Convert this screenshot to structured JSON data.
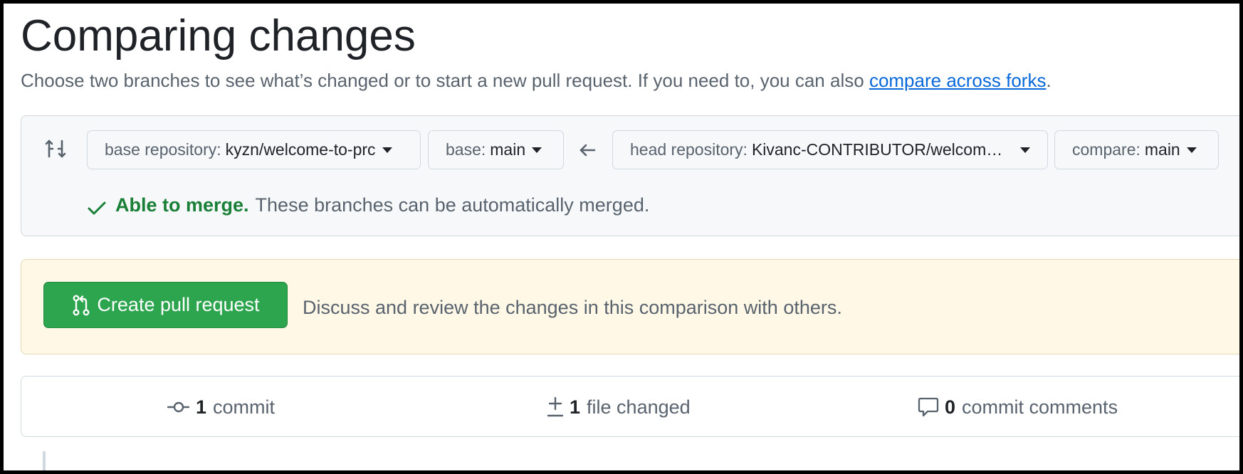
{
  "header": {
    "title": "Comparing changes",
    "subtitle": "Choose two branches to see what’s changed or to start a new pull request. If you need to, you can also",
    "compare_link": "compare across forks",
    "subtitle_end": "."
  },
  "range": {
    "compare_icon": "arrow-switch-icon",
    "base_repository": {
      "label": "base repository:",
      "value": "kyzn/welcome-to-prc"
    },
    "base_branch": {
      "label": "base:",
      "value": "main"
    },
    "direction_icon": "arrow-left-icon",
    "head_repository": {
      "label": "head repository:",
      "value": "Kivanc-CONTRIBUTOR/welcome-to-prc"
    },
    "compare_branch": {
      "label": "compare:",
      "value": "main"
    },
    "merge_status": {
      "icon": "check-icon",
      "bold": "Able to merge.",
      "text": "These branches can be automatically merged."
    }
  },
  "pull_request": {
    "button_icon": "git-pull-request-icon",
    "button_label": "Create pull request",
    "description": "Discuss and review the changes in this comparison with others."
  },
  "stats": {
    "commits": {
      "icon": "git-commit-icon",
      "count": "1",
      "label": "commit"
    },
    "files": {
      "icon": "diff-icon",
      "count": "1",
      "label": "file changed"
    },
    "comments": {
      "icon": "comment-icon",
      "count": "0",
      "label": "commit comments"
    }
  },
  "colors": {
    "link": "#0969da",
    "success_text": "#1a7f37",
    "primary_button": "#2da44e",
    "pr_box_bg": "#fff8e7",
    "muted_text": "#59636e",
    "border": "#d1d9e0"
  }
}
